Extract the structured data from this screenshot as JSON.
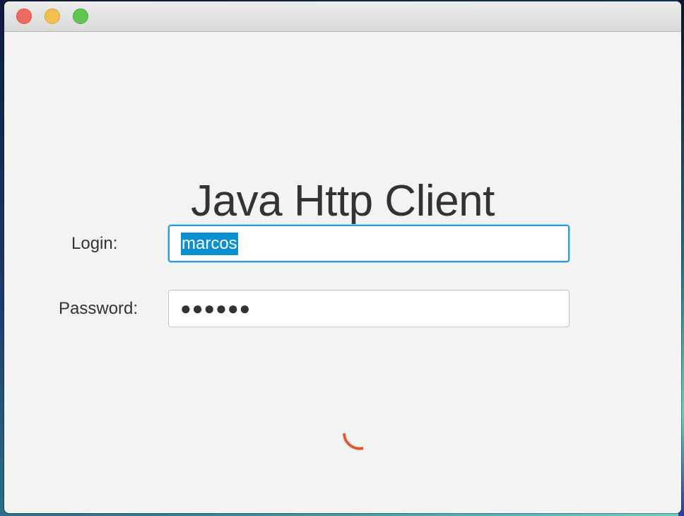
{
  "window": {
    "title_buttons": [
      "close",
      "minimize",
      "maximize"
    ]
  },
  "app": {
    "title": "Java Http Client"
  },
  "form": {
    "login_label": "Login:",
    "login_value": "marcos",
    "password_label": "Password:",
    "password_masked": "●●●●●●"
  },
  "status": {
    "loading": true
  },
  "colors": {
    "selection": "#0a8fd0",
    "focus_ring": "#2c9bd6",
    "spinner": "#e05a2b"
  }
}
